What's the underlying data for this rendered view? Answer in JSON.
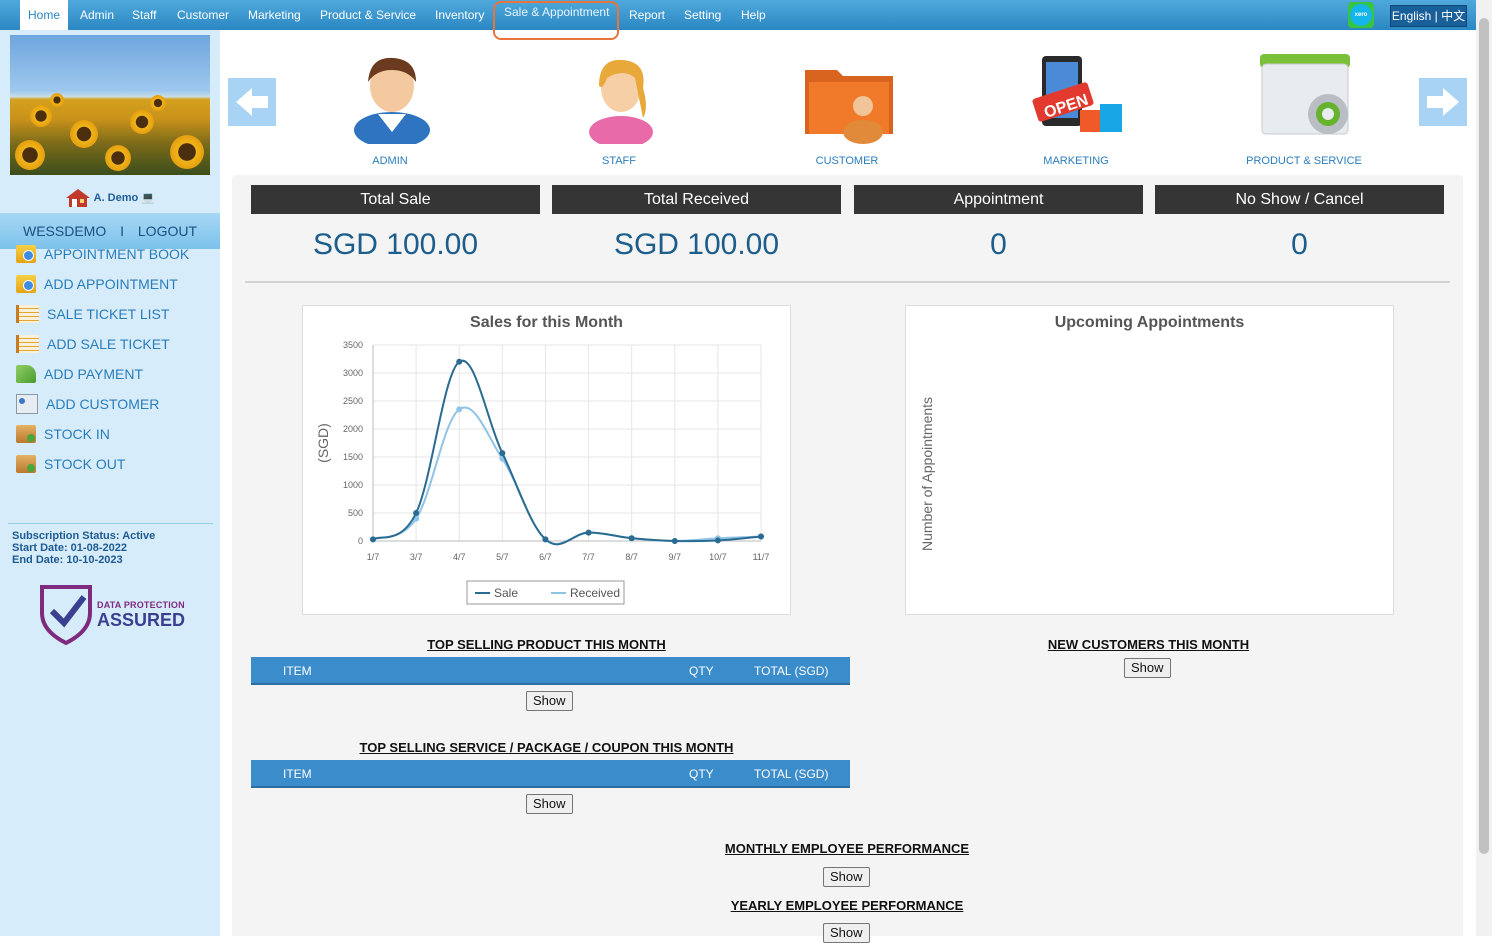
{
  "nav": {
    "items": [
      "Home",
      "Admin",
      "Staff",
      "Customer",
      "Marketing",
      "Product & Service",
      "Inventory",
      "Sale & Appointment",
      "Report",
      "Setting",
      "Help"
    ],
    "active": "Home",
    "highlighted": "Sale & Appointment",
    "xero_label": "xero",
    "language": "English | 中文"
  },
  "sidebar": {
    "user": "A. Demo",
    "username": "WESSDEMO",
    "separator": "I",
    "logout": "LOGOUT",
    "menu": [
      "APPOINTMENT BOOK",
      "ADD APPOINTMENT",
      "SALE TICKET LIST",
      "ADD SALE TICKET",
      "ADD PAYMENT",
      "ADD CUSTOMER",
      "STOCK IN",
      "STOCK OUT"
    ],
    "subscription": {
      "status": "Subscription Status: Active",
      "start": "Start Date: 01-08-2022",
      "end": "End Date: 10-10-2023"
    },
    "badge": {
      "line1": "DATA PROTECTION",
      "line2": "ASSURED"
    }
  },
  "modules": [
    "ADMIN",
    "STAFF",
    "CUSTOMER",
    "MARKETING",
    "PRODUCT & SERVICE"
  ],
  "stats": [
    {
      "label": "Total Sale",
      "value": "SGD 100.00"
    },
    {
      "label": "Total Received",
      "value": "SGD 100.00"
    },
    {
      "label": "Appointment",
      "value": "0"
    },
    {
      "label": "No Show / Cancel",
      "value": "0"
    }
  ],
  "sales_chart_title": "Sales for this Month",
  "appointments_chart_title": "Upcoming Appointments",
  "chart_data": [
    {
      "type": "line",
      "title": "Sales for this Month",
      "ylabel": "(SGD)",
      "xlabel": "",
      "ylim": [
        0,
        3500
      ],
      "yticks": [
        0,
        500,
        1000,
        1500,
        2000,
        2500,
        3000,
        3500
      ],
      "x": [
        "1/7",
        "3/7",
        "4/7",
        "5/7",
        "6/7",
        "7/7",
        "8/7",
        "9/7",
        "10/7",
        "11/7"
      ],
      "series": [
        {
          "name": "Sale",
          "color": "#2a6b92",
          "values": [
            30,
            500,
            3200,
            1570,
            30,
            150,
            50,
            0,
            10,
            80
          ]
        },
        {
          "name": "Received",
          "color": "#8fc4e6",
          "values": [
            30,
            400,
            2350,
            1470,
            30,
            150,
            50,
            0,
            50,
            80
          ]
        }
      ],
      "grid": true,
      "legend": "bottom"
    },
    {
      "type": "line",
      "title": "Upcoming Appointments",
      "ylabel": "Number of Appointments",
      "series": []
    }
  ],
  "top_products": {
    "title": "TOP SELLING PRODUCT THIS MONTH",
    "columns": [
      "ITEM",
      "QTY",
      "TOTAL (SGD)"
    ],
    "button": "Show"
  },
  "top_services": {
    "title": "TOP SELLING SERVICE / PACKAGE / COUPON THIS MONTH",
    "columns": [
      "ITEM",
      "QTY",
      "TOTAL (SGD)"
    ],
    "button": "Show"
  },
  "new_customers": {
    "title": "NEW CUSTOMERS THIS MONTH",
    "button": "Show"
  },
  "monthly_perf": {
    "title": "MONTHLY EMPLOYEE PERFORMANCE",
    "button": "Show"
  },
  "yearly_perf": {
    "title": "YEARLY EMPLOYEE PERFORMANCE",
    "button": "Show"
  }
}
